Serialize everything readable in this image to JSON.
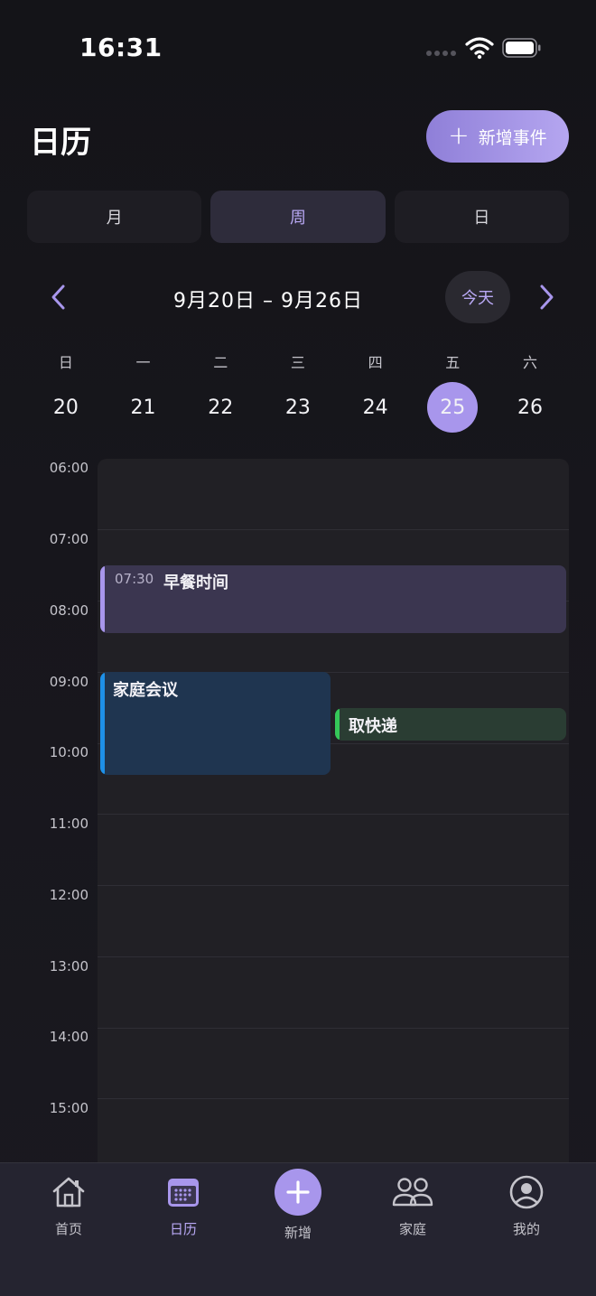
{
  "status_bar": {
    "time": "16:31"
  },
  "header": {
    "title": "日历",
    "add_event_label": "新增事件"
  },
  "view_switcher": {
    "options": [
      "月",
      "周",
      "日"
    ],
    "selected": "周"
  },
  "week_nav": {
    "range": "9月20日 – 9月26日",
    "today_label": "今天"
  },
  "week": {
    "weekdays": [
      "日",
      "一",
      "二",
      "三",
      "四",
      "五",
      "六"
    ],
    "dates": [
      "20",
      "21",
      "22",
      "23",
      "24",
      "25",
      "26"
    ],
    "selected_date": "25"
  },
  "timeline": {
    "hours": [
      "06:00",
      "07:00",
      "08:00",
      "09:00",
      "10:00",
      "11:00",
      "12:00",
      "13:00",
      "14:00",
      "15:00"
    ]
  },
  "events": [
    {
      "time": "07:30",
      "title": "早餐时间",
      "color": "#a896ec"
    },
    {
      "time": "",
      "title": "家庭会议",
      "color": "#1e90e8"
    },
    {
      "time": "",
      "title": "取快递",
      "color": "#35c759"
    }
  ],
  "tabbar": {
    "tabs": [
      {
        "label": "首页",
        "icon": "home-icon"
      },
      {
        "label": "日历",
        "icon": "calendar-icon"
      },
      {
        "label": "新增",
        "icon": "plus-icon"
      },
      {
        "label": "家庭",
        "icon": "people-icon"
      },
      {
        "label": "我的",
        "icon": "profile-icon"
      }
    ],
    "active": "日历"
  },
  "colors": {
    "accent": "#a896ec",
    "background": "#141418",
    "surface": "#212025"
  }
}
